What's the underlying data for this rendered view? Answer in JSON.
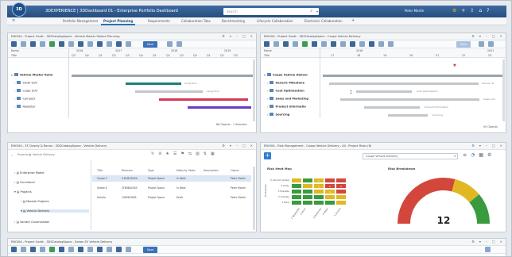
{
  "topbar": {
    "logo_text": "3D",
    "title": "3DEXPERIENCE | 3DDashboard 01 - Enterprise Portfolio Dashboard",
    "search_placeholder": "Search",
    "user": "Peter Martin",
    "search_icon": "search-icon",
    "icons": [
      "gear-icon",
      "plus-icon",
      "share-icon",
      "home-icon",
      "help-icon"
    ]
  },
  "tabs": [
    {
      "label": "Portfolio Management"
    },
    {
      "label": "Project Planning"
    },
    {
      "label": "Requirements"
    },
    {
      "label": "Collaboration Tabs"
    },
    {
      "label": "Benchmarking"
    },
    {
      "label": "Lifecycle Collaboration"
    },
    {
      "label": "Electronic Collaboration"
    }
  ],
  "panels": {
    "p1": {
      "title": "ENOVIA - Project Gantt - 3DSCatalogSpace - Vehicle Master Rollout Planning",
      "name_col": "Name",
      "title_col": "Title",
      "years": [
        "2016",
        "2017",
        "2018",
        "2019"
      ],
      "quarters": [
        "Q3",
        "Q4",
        "Q1",
        "Q2",
        "Q3",
        "Q4",
        "Q1",
        "Q2",
        "Q3",
        "Q4",
        "Q1",
        "Q2",
        "Q3"
      ],
      "rows": [
        "Vehicle Master Rollo",
        "Small SUV",
        "Large SUV",
        "Compact",
        "Roadster"
      ],
      "bar_labels": [
        "Small SUV",
        "Large SUV"
      ],
      "save_label": "Save",
      "footer": "86 Objects - 1 Selected"
    },
    "p2": {
      "title": "ENOVIA - Project Gantt - 3DSCatalogSpace - Coupe Vehicle Delivery",
      "name_col": "Name",
      "title_col": "Title",
      "years": [
        "2016",
        "2021"
      ],
      "weeks": [
        "17",
        "18",
        "19",
        "20",
        "21",
        "22",
        "23"
      ],
      "rows": [
        "Coupe Vehicle Deliver",
        "Generic Milestone",
        "Cost Optimization",
        "Sales and Marketing",
        "Product Informatio",
        "Sourcing"
      ],
      "bar_labels": [
        "Generic M",
        "Cost Optimization",
        "Sales and",
        "Product Information",
        "Sourcing"
      ],
      "save_label": "Save",
      "footer": "95 Objects"
    },
    "p3": {
      "title": "ENOVIA - 3F Closely & Ronan - 3DSCatalogSpace - Vehicle Delivery",
      "breadcrumb": "Projects  ▶  Vehicle Delivery",
      "tree": [
        "Enterprise Model",
        "Functional",
        "Projects",
        "Module Projects",
        "Vehicle Delivery",
        "Variant Canonization"
      ],
      "table_headers": [
        "Title",
        "Revision",
        "Type",
        "Maturity State",
        "Description",
        "Owner"
      ],
      "table_rows": [
        [
          "Coupe Y",
          "3.6CBC9D5A",
          "Project Space",
          "In Work",
          "",
          "Peter Martin"
        ],
        [
          "Sedan K",
          "2F80BA03FA",
          "Project Space",
          "In Work",
          "",
          "Peter Martin"
        ],
        [
          "Vehicle",
          "1060DC80B",
          "Project Space",
          "Draft",
          "",
          "Peter Martin"
        ]
      ]
    },
    "p4": {
      "title": "ENOVIA - Risk Management - Coupe Vehicle Delivery - All - Project Risks (6)",
      "combo_value": "Coupe Vehicle Delivery",
      "heatmap_title": "Risk Heat Map",
      "breakdown_title": "Risk Breakdown",
      "y_axis_label": "Probability",
      "probability_labels": [
        "5 Almost Certain",
        "4 Likely",
        "3 Possible",
        "2 Unlikely",
        "1 Rare"
      ],
      "impact_labels": [
        "1 Negligible",
        "2 Minor",
        "3 Moderate",
        "4 Major",
        "5 Severe"
      ],
      "heatmap_colors": [
        [
          "#e0b823",
          "#3a9b3e",
          "#e0b823",
          "#d3463c",
          "#d3463c"
        ],
        [
          "#3a9b3e",
          "#e0b823",
          "#e0b823",
          "#d3463c",
          "#d3463c"
        ],
        [
          "#3a9b3e",
          "#3a9b3e",
          "#e0b823",
          "#e0b823",
          "#d3463c"
        ],
        [
          "#3a9b3e",
          "#3a9b3e",
          "#3a9b3e",
          "#e0b823",
          "#e0b823"
        ],
        [
          "#3a9b3e",
          "#3a9b3e",
          "#3a9b3e",
          "#3a9b3e",
          "#e0b823"
        ]
      ],
      "heatmap_values": [
        [
          "",
          "",
          "1",
          "",
          ""
        ],
        [
          "",
          "",
          "1",
          "2",
          "1"
        ],
        [
          "",
          "",
          "",
          "1",
          ""
        ],
        [
          "",
          "",
          "",
          "",
          ""
        ],
        [
          "",
          "",
          "",
          "",
          ""
        ]
      ],
      "gauge_value": "12",
      "gauge_colors": [
        "#d3463c",
        "#e0b823",
        "#3a9b3e"
      ]
    },
    "p5": {
      "title": "ENOVIA - Project Gantt - 3DSCatalogSpace - Sedan EV Vehicle Delivery",
      "save_label": "Save"
    }
  }
}
